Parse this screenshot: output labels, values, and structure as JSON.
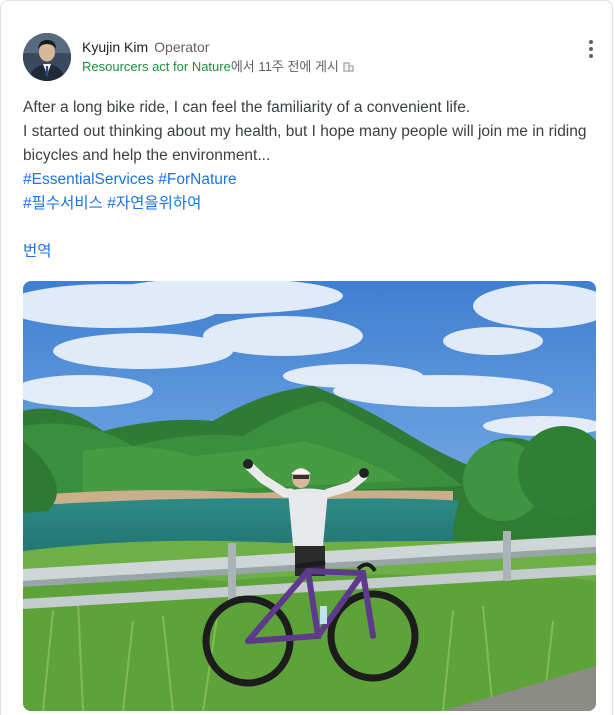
{
  "post": {
    "author": {
      "name": "Kyujin Kim",
      "role": "Operator",
      "avatar_icon": "person-avatar"
    },
    "meta": {
      "community": "Resourcers act for Nature",
      "posted_suffix": "에서 11주 전에 게시",
      "icon": "building-icon"
    },
    "menu_icon": "more-vert-icon",
    "body_lines": [
      "After a long bike ride, I can feel the familiarity of a convenient life.",
      "I started out thinking about my health, but I hope many people will join me in riding bicycles and help the environment..."
    ],
    "hashtags": {
      "english": [
        "#EssentialServices",
        "#ForNature"
      ],
      "korean": [
        "#필수서비스",
        "#자연을위하여"
      ]
    },
    "translate_label": "번역",
    "photo": {
      "subject": "cyclist-with-purple-road-bike-by-lake-and-mountains"
    }
  },
  "colors": {
    "link_green": "#1e8e3e",
    "link_blue": "#1a73e8",
    "text_secondary": "#5f6368",
    "bike_purple": "#5e3a8c"
  }
}
